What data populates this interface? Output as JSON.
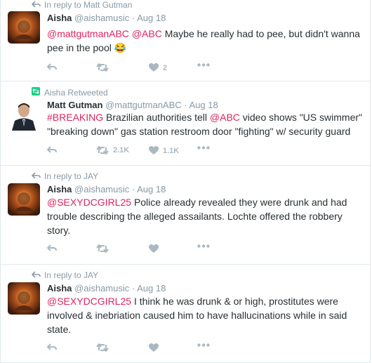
{
  "colors": {
    "accent": "#e0245e",
    "muted": "#8899a6",
    "action": "#aab8c2",
    "retweet": "#19cf86"
  },
  "tweets": [
    {
      "context": "In reply to Matt Gutman",
      "context_icon": "reply-arrow-icon",
      "name": "Aisha",
      "handle": "@aishamusic",
      "dot": "·",
      "time": "Aug 18",
      "mentions": [
        "@mattgutmanABC",
        "@ABC"
      ],
      "body": "Maybe he really had to pee, but didn't wanna pee in the pool",
      "emoji": "😂",
      "likes": "2",
      "retweets": ""
    },
    {
      "context": "Aisha Retweeted",
      "context_icon": "retweet-icon",
      "name": "Matt Gutman",
      "handle": "@mattgutmanABC",
      "dot": "·",
      "time": "Aug 18",
      "hashtag": "#BREAKING",
      "body_a": "Brazilian authorities tell",
      "mention": "@ABC",
      "body_b": "video shows \"US swimmer\" \"breaking down\" gas station restroom door \"fighting\" w/ security guard",
      "retweets": "2.1K",
      "likes": "1.1K"
    },
    {
      "context": "In reply to JAY",
      "context_icon": "reply-arrow-icon",
      "name": "Aisha",
      "handle": "@aishamusic",
      "dot": "·",
      "time": "Aug 18",
      "mention": "@SEXYDCGIRL25",
      "body": "Police already revealed they were drunk and had trouble describing the alleged assailants. Lochte offered the robbery story.",
      "retweets": "",
      "likes": ""
    },
    {
      "context": "In reply to JAY",
      "context_icon": "reply-arrow-icon",
      "name": "Aisha",
      "handle": "@aishamusic",
      "dot": "·",
      "time": "Aug 18",
      "mention": "@SEXYDCGIRL25",
      "body": "I think he was drunk & or high, prostitutes were involved & inebriation caused him to have hallucinations while in said state.",
      "retweets": "",
      "likes": ""
    }
  ]
}
